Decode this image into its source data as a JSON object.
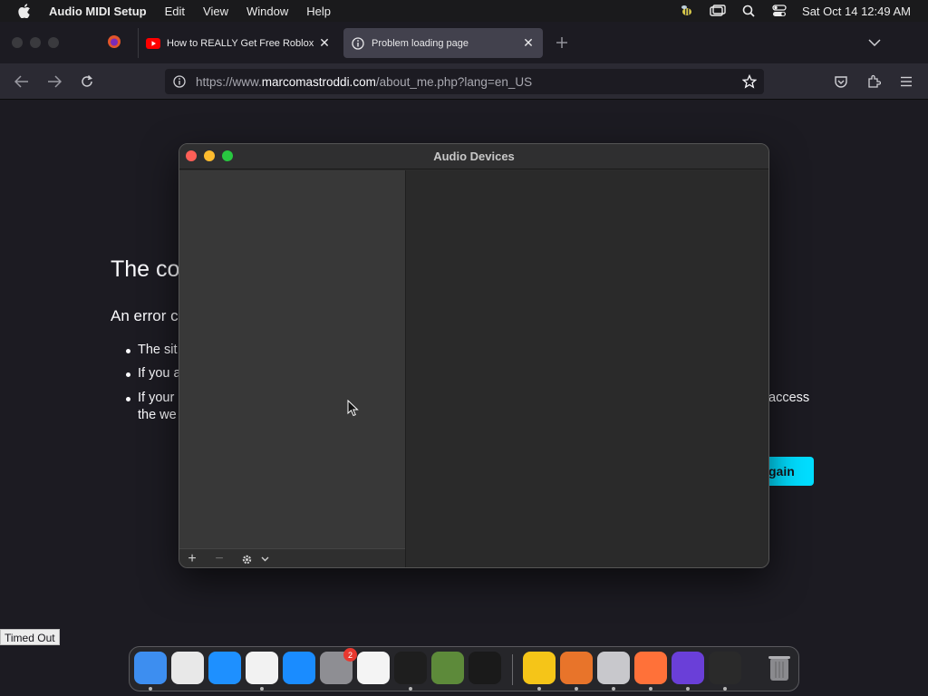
{
  "menubar": {
    "app_name": "Audio MIDI Setup",
    "menus": [
      "Edit",
      "View",
      "Window",
      "Help"
    ],
    "clock": "Sat Oct 14  12:49 AM",
    "status_icons": [
      "bee-icon",
      "screen-mirroring-icon",
      "search-icon",
      "control-center-icon"
    ]
  },
  "browser": {
    "tabs": [
      {
        "title": "How to REALLY Get Free Roblox",
        "icon": "youtube-icon",
        "active": false
      },
      {
        "title": "Problem loading page",
        "icon": "info-icon",
        "active": true
      }
    ],
    "url": {
      "prefix": "https://www.",
      "domain": "marcomastroddi.com",
      "path": "/about_me.php?lang=en_US"
    },
    "status_tooltip": "Timed Out"
  },
  "error_page": {
    "title_fragment": "The co",
    "subtitle_fragment": "An error c",
    "bullets": [
      "The sit",
      "If you a",
      "If your"
    ],
    "bullet3_line2": "the we",
    "access_fragment": "access",
    "button_fragment": "gain"
  },
  "audio_window": {
    "title": "Audio Devices",
    "footer_buttons": [
      "+",
      "−",
      "gear-icon",
      "chevron-down-icon"
    ]
  },
  "dock": {
    "apps": [
      {
        "name": "finder",
        "color": "#3d8ef0",
        "running": true
      },
      {
        "name": "launchpad",
        "color": "#e8e8e8",
        "running": false
      },
      {
        "name": "safari",
        "color": "#1e90ff",
        "running": false
      },
      {
        "name": "chrome",
        "color": "#f2f2f2",
        "running": true
      },
      {
        "name": "app-store",
        "color": "#1a8cff",
        "running": false
      },
      {
        "name": "system-preferences",
        "color": "#8e8e93",
        "running": false,
        "badge": "2"
      },
      {
        "name": "textedit",
        "color": "#f4f4f4",
        "running": false
      },
      {
        "name": "terminal",
        "color": "#1e1e1e",
        "running": true
      },
      {
        "name": "minecraft",
        "color": "#5d8a3a",
        "running": false
      },
      {
        "name": "chatgpt",
        "color": "#1a1a1a",
        "running": false
      },
      {
        "name": "cyberduck",
        "color": "#f5c518",
        "running": true
      },
      {
        "name": "downloads",
        "color": "#e8742a",
        "running": true
      },
      {
        "name": "system-settings",
        "color": "#c8c8cc",
        "running": true
      },
      {
        "name": "firefox",
        "color": "#ff7139",
        "running": true
      },
      {
        "name": "notchmeister",
        "color": "#6a3fd8",
        "running": true
      },
      {
        "name": "audio-midi-setup",
        "color": "#2a2a2a",
        "running": true
      }
    ],
    "trash": "trash-icon"
  }
}
